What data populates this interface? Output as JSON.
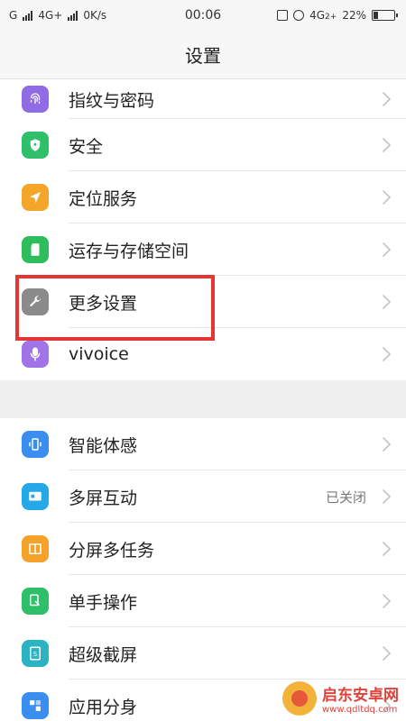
{
  "status_bar": {
    "carrier_1": "G",
    "network": "4G+",
    "speed": "0K/s",
    "time": "00:06",
    "network_2": "4G",
    "network_2_suffix": "2+",
    "battery_percent": "22%",
    "battery_level": 0.22
  },
  "header": {
    "title": "设置"
  },
  "group1": [
    {
      "label": "指纹与密码",
      "icon": "fingerprint-icon",
      "color": "#8f6be6"
    },
    {
      "label": "安全",
      "icon": "shield-icon",
      "color": "#2fbf6a"
    },
    {
      "label": "定位服务",
      "icon": "location-arrow-icon",
      "color": "#f4a62a"
    },
    {
      "label": "运存与存储空间",
      "icon": "sd-card-icon",
      "color": "#2ebd5b"
    },
    {
      "label": "更多设置",
      "icon": "wrench-icon",
      "color": "#8a8a8a"
    },
    {
      "label": "vivoice",
      "icon": "microphone-icon",
      "color": "#a073e8"
    }
  ],
  "group2": [
    {
      "label": "智能体感",
      "icon": "phone-motion-icon",
      "color": "#3a8ef0",
      "value": ""
    },
    {
      "label": "多屏互动",
      "icon": "screen-cast-icon",
      "color": "#25a8e8",
      "value": "已关闭"
    },
    {
      "label": "分屏多任务",
      "icon": "split-screen-icon",
      "color": "#f4a22a",
      "value": ""
    },
    {
      "label": "单手操作",
      "icon": "one-hand-icon",
      "color": "#2fbf6a",
      "value": ""
    },
    {
      "label": "超级截屏",
      "icon": "screenshot-icon",
      "color": "#2bb3c4",
      "value": ""
    },
    {
      "label": "应用分身",
      "icon": "app-clone-icon",
      "color": "#3a8ef0",
      "value": ""
    }
  ],
  "watermark": {
    "name": "启东安卓网",
    "url": "www.qdltdq.com"
  }
}
